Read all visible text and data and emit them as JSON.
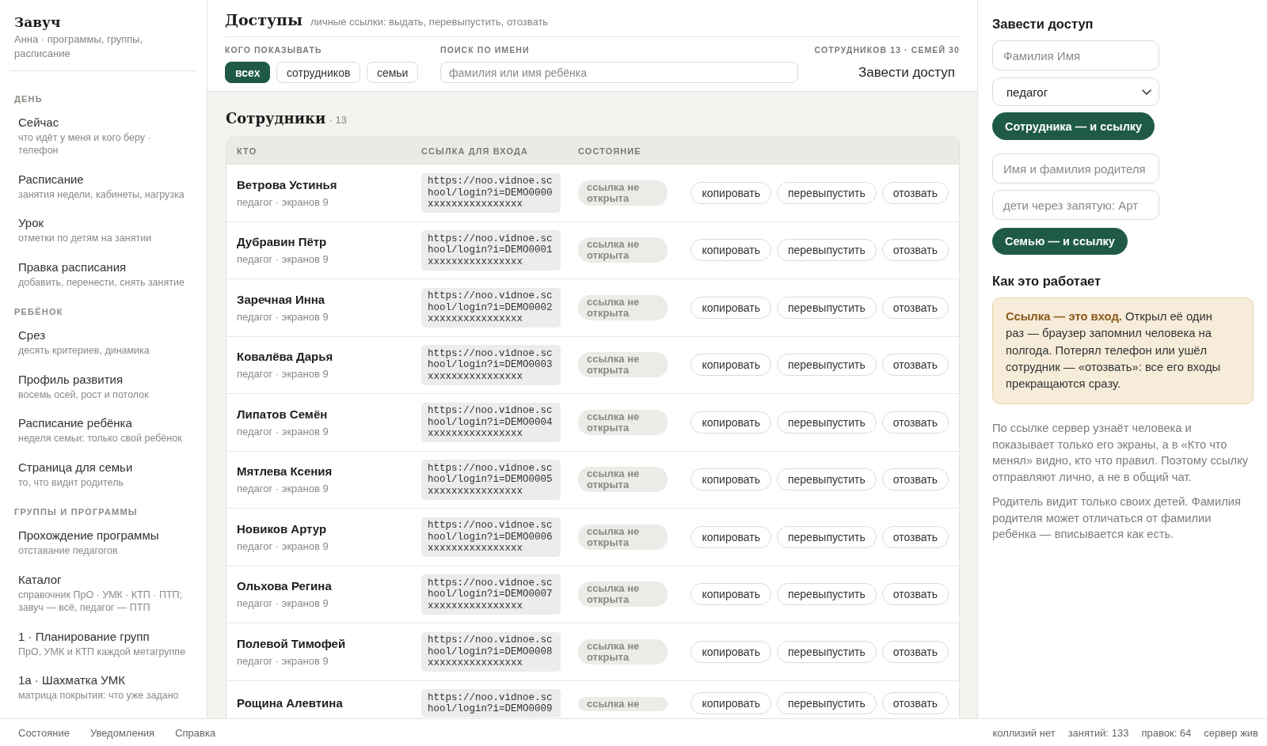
{
  "sidebar": {
    "title": "Завуч",
    "subtitle": "Анна · программы, группы, расписание",
    "sections": [
      {
        "label": "ДЕНЬ",
        "items": [
          {
            "title": "Сейчас",
            "subtitle": "что идёт у меня и кого беру · телефон"
          },
          {
            "title": "Расписание",
            "subtitle": "занятия недели, кабинеты, нагрузка"
          },
          {
            "title": "Урок",
            "subtitle": "отметки по детям на занятии"
          },
          {
            "title": "Правка расписания",
            "subtitle": "добавить, перенести, снять занятие"
          }
        ]
      },
      {
        "label": "РЕБЁНОК",
        "items": [
          {
            "title": "Срез",
            "subtitle": "десять критериев, динамика"
          },
          {
            "title": "Профиль развития",
            "subtitle": "восемь осей, рост и потолок"
          },
          {
            "title": "Расписание ребёнка",
            "subtitle": "неделя семьи: только свой ребёнок"
          },
          {
            "title": "Страница для семьи",
            "subtitle": "то, что видит родитель"
          }
        ]
      },
      {
        "label": "ГРУППЫ И ПРОГРАММЫ",
        "items": [
          {
            "title": "Прохождение программы",
            "subtitle": "отставание педагогов"
          },
          {
            "title": "Каталог",
            "subtitle": "справочник ПрО · УМК · КТП · ПТП; завуч — всё, педагог — ПТП"
          },
          {
            "title": "1 · Планирование групп",
            "subtitle": "ПрО, УМК и КТП каждой метагруппе"
          },
          {
            "title": "1а · Шахматка УМК",
            "subtitle": "матрица покрытия: что уже задано"
          }
        ]
      }
    ]
  },
  "header": {
    "title": "Доступы",
    "subtitle": "личные ссылки: выдать, перевыпустить, отозвать",
    "filter_label": "КОГО ПОКАЗЫВАТЬ",
    "filters": [
      {
        "label": "всех",
        "selected": true
      },
      {
        "label": "сотрудников",
        "selected": false
      },
      {
        "label": "семьи",
        "selected": false
      }
    ],
    "search": {
      "label": "ПОИСК ПО ИМЕНИ",
      "placeholder": "фамилия или имя ребёнка"
    },
    "counts": "СОТРУДНИКОВ 13 · СЕМЕЙ 30",
    "action": "Завести доступ"
  },
  "staff": {
    "title": "Сотрудники",
    "count": "· 13",
    "columns": [
      "КТО",
      "ССЫЛКА ДЛЯ ВХОДА",
      "СОСТОЯНИЕ"
    ],
    "rows": [
      {
        "name": "Ветрова Устинья",
        "role": "педагог · экранов 9",
        "link": "https://noo.vidnoe.school/login?i=DEMO0000xxxxxxxxxxxxxxxx",
        "state": "ссылка не открыта",
        "actions": [
          "копировать",
          "перевыпустить",
          "отозвать"
        ]
      },
      {
        "name": "Дубравин Пётр",
        "role": "педагог · экранов 9",
        "link": "https://noo.vidnoe.school/login?i=DEMO0001xxxxxxxxxxxxxxxx",
        "state": "ссылка не открыта",
        "actions": [
          "копировать",
          "перевыпустить",
          "отозвать"
        ]
      },
      {
        "name": "Заречная Инна",
        "role": "педагог · экранов 9",
        "link": "https://noo.vidnoe.school/login?i=DEMO0002xxxxxxxxxxxxxxxx",
        "state": "ссылка не открыта",
        "actions": [
          "копировать",
          "перевыпустить",
          "отозвать"
        ]
      },
      {
        "name": "Ковалёва Дарья",
        "role": "педагог · экранов 9",
        "link": "https://noo.vidnoe.school/login?i=DEMO0003xxxxxxxxxxxxxxxx",
        "state": "ссылка не открыта",
        "actions": [
          "копировать",
          "перевыпустить",
          "отозвать"
        ]
      },
      {
        "name": "Липатов Семён",
        "role": "педагог · экранов 9",
        "link": "https://noo.vidnoe.school/login?i=DEMO0004xxxxxxxxxxxxxxxx",
        "state": "ссылка не открыта",
        "actions": [
          "копировать",
          "перевыпустить",
          "отозвать"
        ]
      },
      {
        "name": "Мятлева Ксения",
        "role": "педагог · экранов 9",
        "link": "https://noo.vidnoe.school/login?i=DEMO0005xxxxxxxxxxxxxxxx",
        "state": "ссылка не открыта",
        "actions": [
          "копировать",
          "перевыпустить",
          "отозвать"
        ]
      },
      {
        "name": "Новиков Артур",
        "role": "педагог · экранов 9",
        "link": "https://noo.vidnoe.school/login?i=DEMO0006xxxxxxxxxxxxxxxx",
        "state": "ссылка не открыта",
        "actions": [
          "копировать",
          "перевыпустить",
          "отозвать"
        ]
      },
      {
        "name": "Ольхова Регина",
        "role": "педагог · экранов 9",
        "link": "https://noo.vidnoe.school/login?i=DEMO0007xxxxxxxxxxxxxxxx",
        "state": "ссылка не открыта",
        "actions": [
          "копировать",
          "перевыпустить",
          "отозвать"
        ]
      },
      {
        "name": "Полевой Тимофей",
        "role": "педагог · экранов 9",
        "link": "https://noo.vidnoe.school/login?i=DEMO0008xxxxxxxxxxxxxxxx",
        "state": "ссылка не открыта",
        "actions": [
          "копировать",
          "перевыпустить",
          "отозвать"
        ]
      },
      {
        "name": "Рощина Алевтина",
        "link": "https://noo.vidnoe.school/login?i=DEMO0009",
        "state": "ссылка не",
        "actions": [
          "копировать",
          "перевыпустить",
          "отозвать"
        ]
      }
    ]
  },
  "create_panel": {
    "title": "Завести доступ",
    "staff_name": {
      "placeholder": "Фамилия Имя"
    },
    "role_select": {
      "value": "педагог"
    },
    "staff_button": "Сотрудника — и ссылку",
    "parent_name": {
      "placeholder": "Имя и фамилия родителя"
    },
    "children": {
      "placeholder": "дети через запятую: Арт"
    },
    "family_button": "Семью — и ссылку",
    "how_title": "Как это работает",
    "note": "**Ссылка — это вход.** Открыл её один раз — браузер запомнил человека на полгода. Потерял телефон или ушёл сотрудник — «отозвать»: все его входы прекращаются сразу.",
    "paragraphs": [
      "По ссылке сервер узнаёт человека и показывает только его экраны, а в «Кто что менял» видно, кто что правил. Поэтому ссылку отправляют лично, а не в общий чат.",
      "Родитель видит только своих детей. Фамилия родителя может отличаться от фамилии ребёнка — вписывается как есть."
    ]
  },
  "status_bar": {
    "links": [
      "Состояние",
      "Уведомления",
      "Справка"
    ],
    "stats": [
      "коллизий нет",
      "занятий: 133",
      "правок: 64",
      "сервер жив"
    ]
  }
}
